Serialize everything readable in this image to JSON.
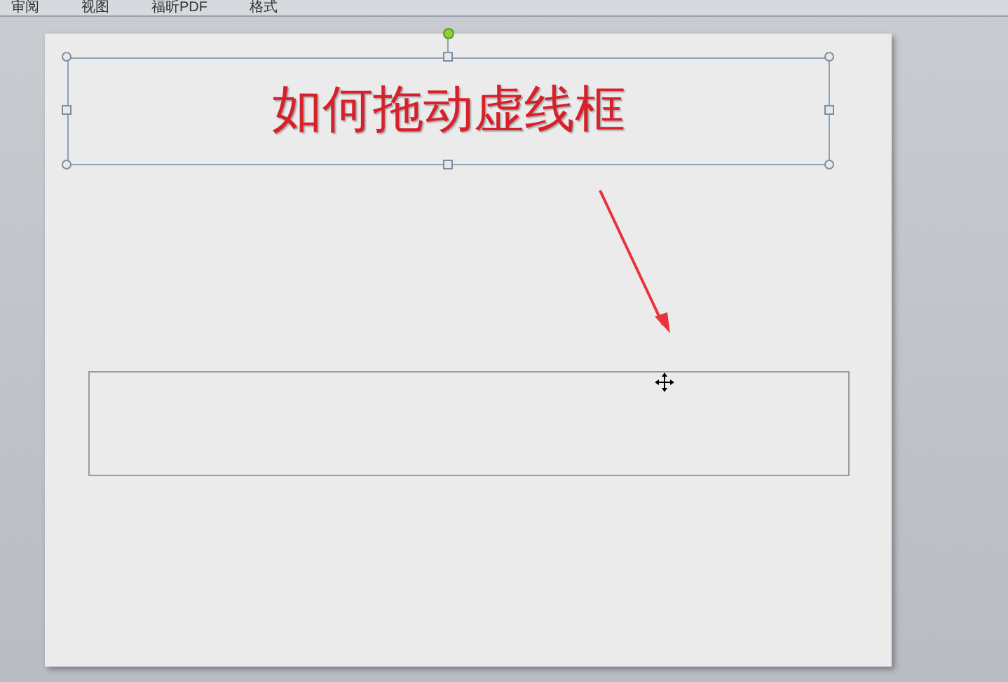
{
  "ribbon_tabs": [
    {
      "label": "审阅"
    },
    {
      "label": "视图"
    },
    {
      "label": "福昕PDF"
    },
    {
      "label": "格式"
    }
  ],
  "slide": {
    "title_box": {
      "text": "如何拖动虚线框",
      "selected": true
    }
  }
}
